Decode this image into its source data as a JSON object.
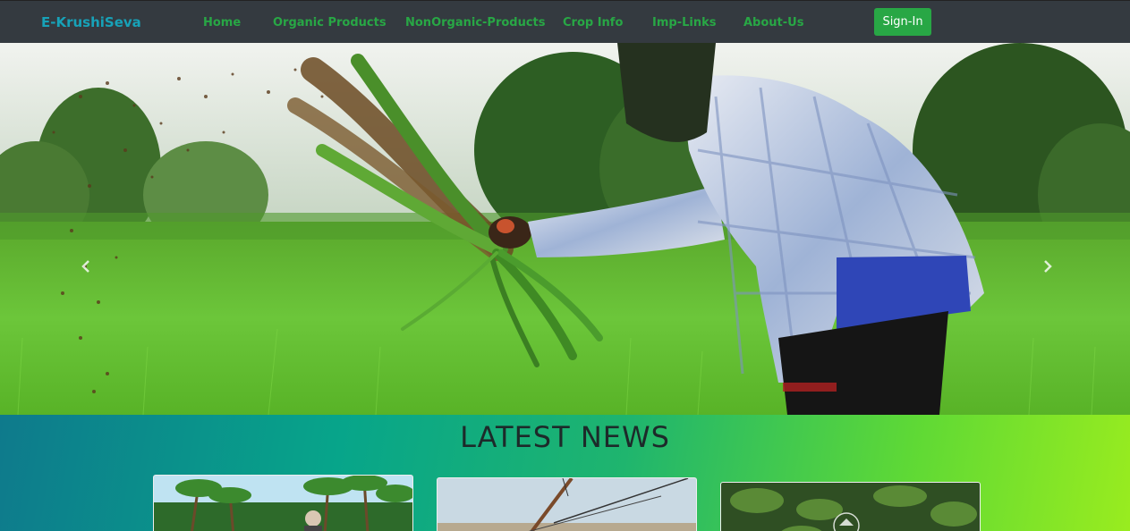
{
  "navbar": {
    "brand": "E-KrushiSeva",
    "links": [
      "Home",
      "Organic Products",
      "NonOrganic-Products",
      "Crop Info",
      "Imp-Links",
      "About-Us"
    ],
    "signin_label": "Sign-In"
  },
  "carousel": {
    "slide_count": 3,
    "active_index": 0
  },
  "news": {
    "title": "LATEST NEWS"
  },
  "colors": {
    "navbar_bg": "#343a40",
    "brand": "#17a2b8",
    "nav_link": "#28a745",
    "signin_bg": "#28a745"
  },
  "icons": {
    "prev": "chevron-left-icon",
    "next": "chevron-right-icon"
  }
}
